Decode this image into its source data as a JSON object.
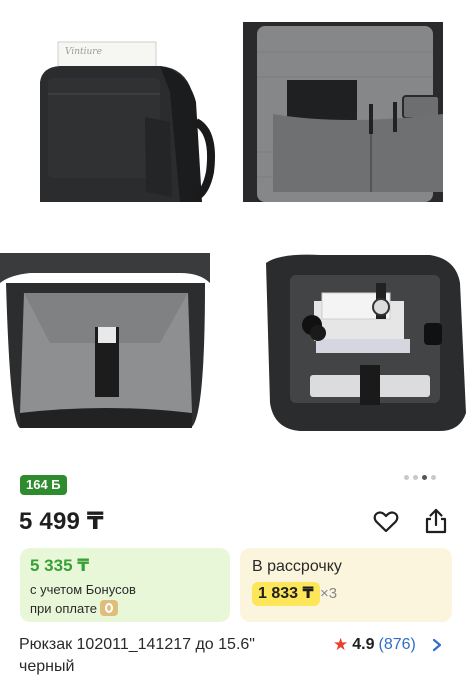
{
  "gallery": {
    "photos": [
      {
        "name": "backpack-front-pocket-photo",
        "notebook_text": "Vintiure"
      },
      {
        "name": "backpack-inner-pockets-photo"
      },
      {
        "name": "backpack-laptop-compartment-photo"
      },
      {
        "name": "backpack-contents-photo"
      }
    ],
    "pager": {
      "count": 4,
      "active_index": 2
    }
  },
  "bonus_badge": "164 Б",
  "price": "5 499 ₸",
  "actions": {
    "favorite_icon": "heart-icon",
    "share_icon": "share-icon"
  },
  "bonus_card": {
    "price": "5 335 ₸",
    "line1": "с учетом Бонусов",
    "line2": "при оплате"
  },
  "installment_card": {
    "title": "В рассрочку",
    "amount": "1 833 ₸",
    "times": "×3"
  },
  "product": {
    "title_line1": "Рюкзак 102011_141217 до 15.6\"",
    "title_line2": "черный",
    "rating": "4.9",
    "reviews": "(876)"
  },
  "colors": {
    "bonus_green": "#2e8b2e",
    "price_green": "#36a135",
    "review_blue": "#2f6fc5",
    "star_red": "#e8402e",
    "pill_yellow": "#fde65a"
  }
}
